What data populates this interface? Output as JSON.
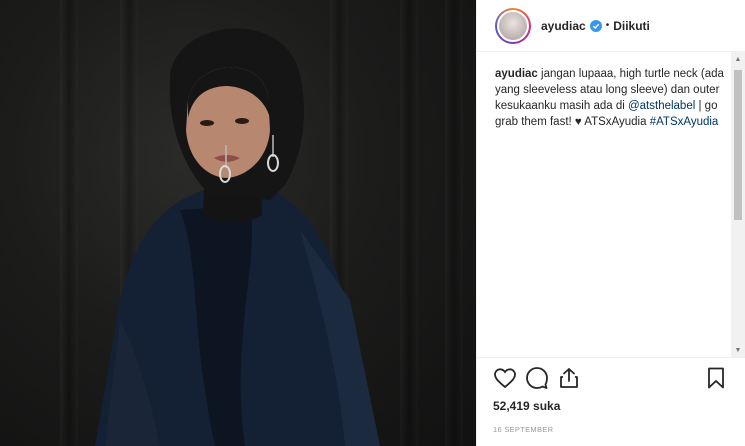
{
  "post": {
    "photo_alt": "",
    "author": {
      "username": "ayudiac",
      "verified": true,
      "follow_status": "Diikuti"
    },
    "caption": {
      "username": "ayudiac",
      "text_before_link": "jangan lupaaa, high turtle neck (ada yang sleeveless atau long sleeve) dan outer kesukaanku masih ada di",
      "mention": "@atsthelabel",
      "text_after_mention": "| go grab them fast! ♥ ATSxAyudia",
      "hashtag": "#ATSxAyudia"
    },
    "actions": {
      "like_icon": "heart-icon",
      "comment_icon": "comment-icon",
      "share_icon": "share-icon",
      "save_icon": "bookmark-icon"
    },
    "likes": "52,419 suka",
    "date": "16 SEPTEMBER"
  },
  "colors": {
    "link": "#003569",
    "verified": "#3897f0"
  }
}
